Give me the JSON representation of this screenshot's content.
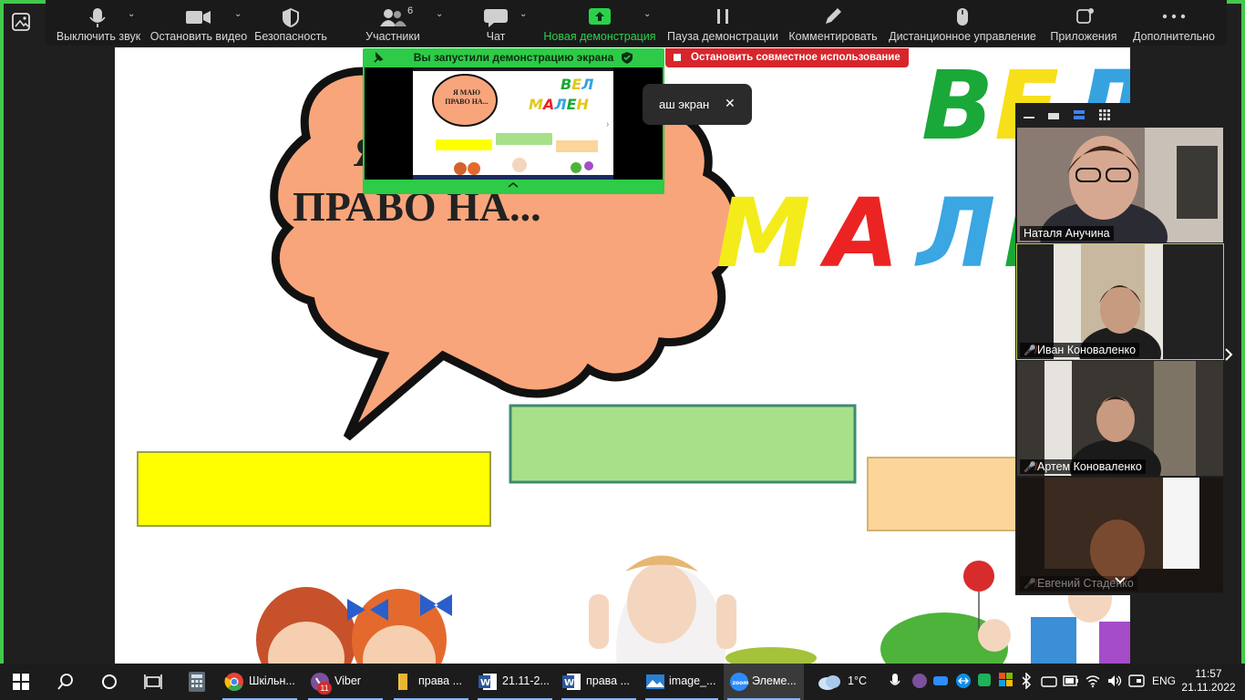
{
  "toolbar": {
    "mute": "Выключить звук",
    "video": "Остановить видео",
    "security": "Безопасность",
    "participants": "Участники",
    "participants_count": "6",
    "chat": "Чат",
    "new_share": "Новая демонстрация",
    "pause_share": "Пауза демонстрации",
    "annotate": "Комментировать",
    "remote_control": "Дистанционное управление",
    "apps": "Приложения",
    "more": "Дополнительно"
  },
  "share": {
    "banner_title": "Вы запустили демонстрацию экрана",
    "stop_label": "Остановить совместное использование",
    "pill_text": "аш экран",
    "pill_close": "✕"
  },
  "slide": {
    "bubble_text_line1": "Я",
    "bubble_text_line2": "ПРАВО НА...",
    "big_word1": "ВЕЛ",
    "big_word2": "МАЛЕ",
    "preview_bubble": "Я МАЮ ПРАВО НА...",
    "preview_word1": "ВЕЛ",
    "preview_word2": "МАЛЕН"
  },
  "participants": [
    {
      "name": "Наталя Анучина",
      "muted": false
    },
    {
      "name": "Иван Коноваленко",
      "muted": true
    },
    {
      "name": "Артем Коноваленко",
      "muted": true
    },
    {
      "name": "Евгений Стаденко",
      "muted": true
    }
  ],
  "taskbar": {
    "items": [
      {
        "label": "Шкільн..."
      },
      {
        "label": "Viber",
        "badge": "11"
      },
      {
        "label": "права ..."
      },
      {
        "label": "21.11-2..."
      },
      {
        "label": "права ..."
      },
      {
        "label": "image_..."
      },
      {
        "label": "Элеме..."
      }
    ],
    "weather": "1°C",
    "language": "ENG",
    "time": "11:57",
    "date": "21.11.2022"
  },
  "colors": {
    "share_green": "#2dcb47",
    "stop_red": "#d6262c",
    "bubble_fill": "#f9a57b",
    "yellow_box": "#ffff00",
    "green_box": "#a8e08a",
    "orange_box": "#fbd59a"
  }
}
